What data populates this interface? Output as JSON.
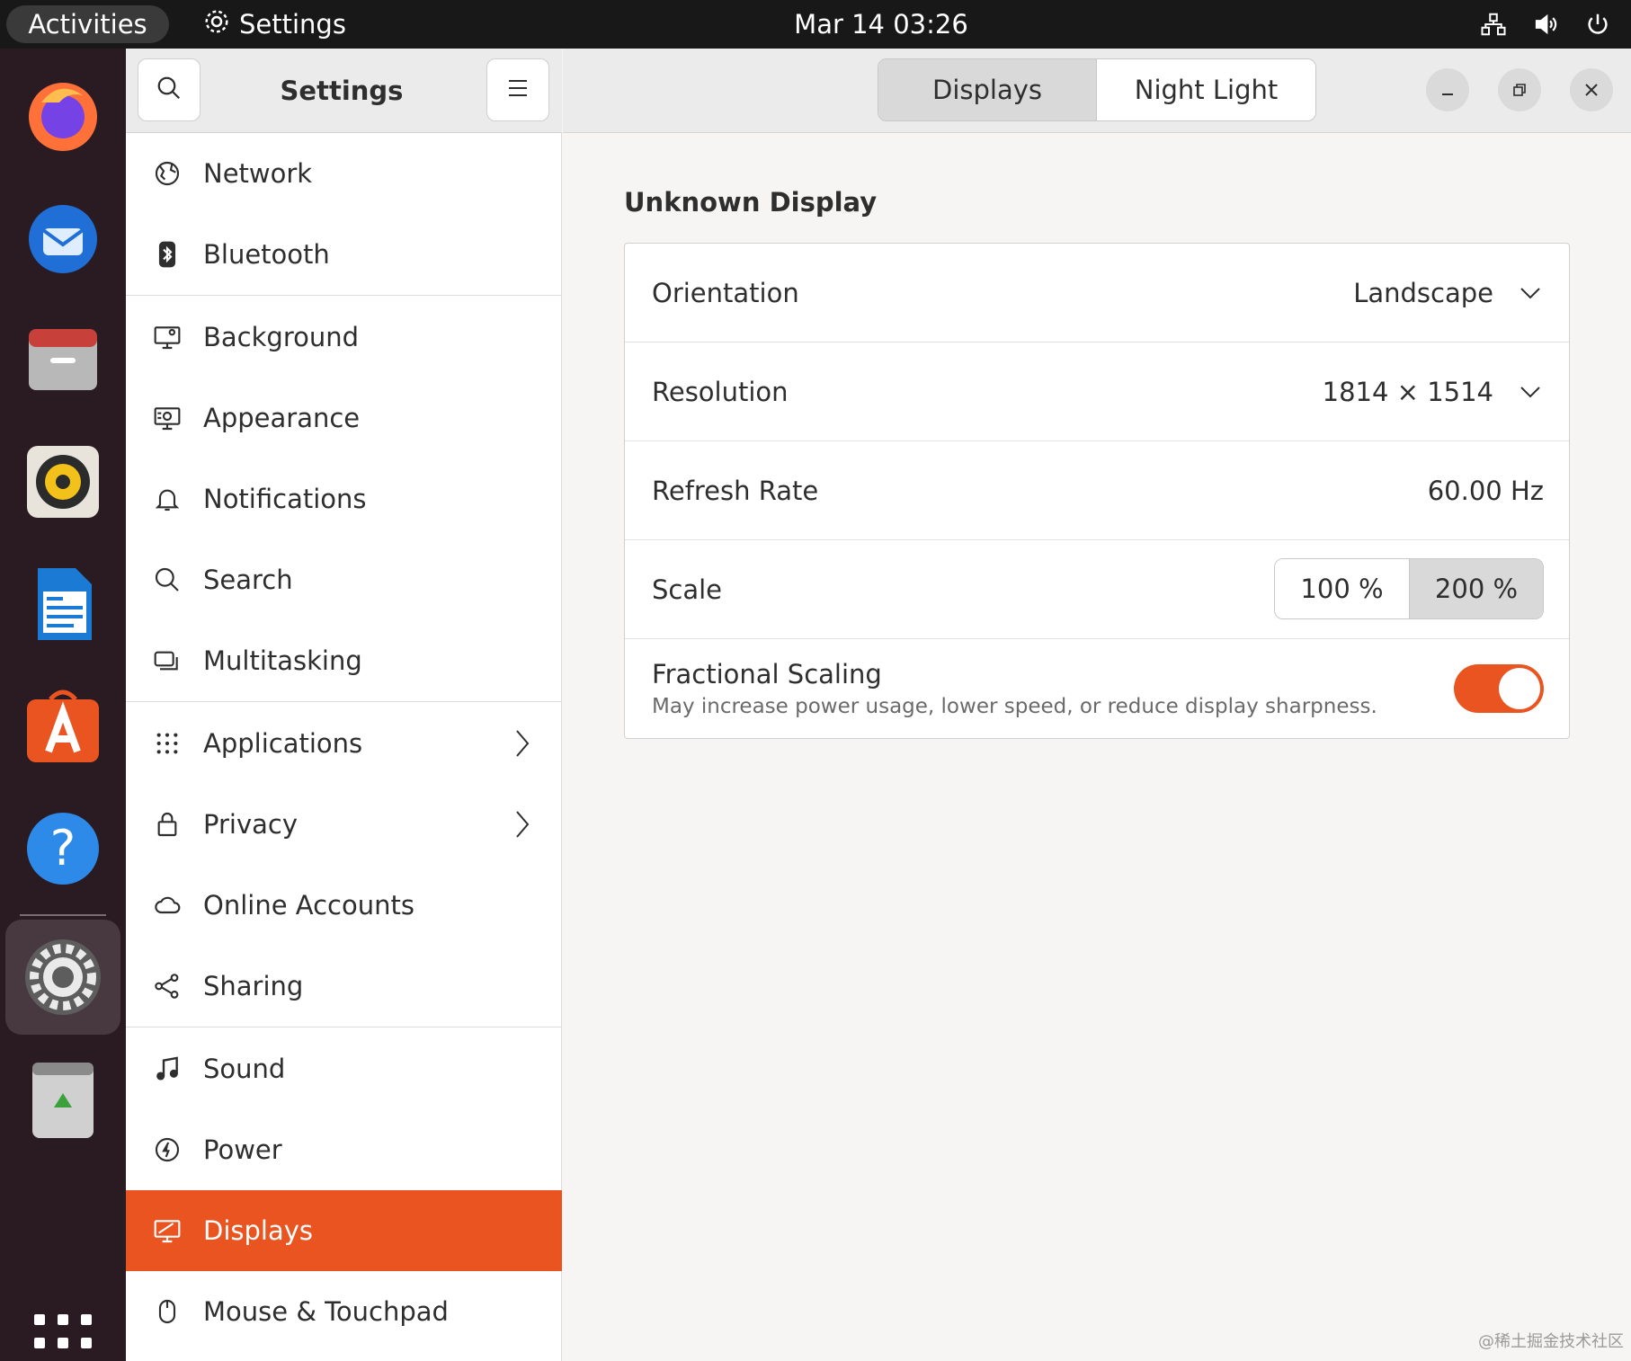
{
  "topbar": {
    "activities_label": "Activities",
    "app_name": "Settings",
    "clock": "Mar 14  03:26",
    "tray_icons": [
      "network-icon",
      "volume-icon",
      "power-icon"
    ]
  },
  "dock": {
    "items": [
      "firefox-icon",
      "thunderbird-icon",
      "files-icon",
      "rhythmbox-icon",
      "writer-icon",
      "app-center-icon",
      "help-icon",
      "settings-icon",
      "trash-icon"
    ],
    "active_item": "settings-icon"
  },
  "sidebar": {
    "title": "Settings",
    "items": [
      {
        "label": "Network",
        "icon": "network-icon"
      },
      {
        "label": "Bluetooth",
        "icon": "bluetooth-icon"
      },
      {
        "label": "Background",
        "icon": "background-icon"
      },
      {
        "label": "Appearance",
        "icon": "appearance-icon"
      },
      {
        "label": "Notifications",
        "icon": "bell-icon"
      },
      {
        "label": "Search",
        "icon": "search-icon"
      },
      {
        "label": "Multitasking",
        "icon": "multitasking-icon"
      },
      {
        "label": "Applications",
        "icon": "grid-icon"
      },
      {
        "label": "Privacy",
        "icon": "lock-icon"
      },
      {
        "label": "Online Accounts",
        "icon": "cloud-icon"
      },
      {
        "label": "Sharing",
        "icon": "share-icon"
      },
      {
        "label": "Sound",
        "icon": "music-note-icon"
      },
      {
        "label": "Power",
        "icon": "power-icon"
      },
      {
        "label": "Displays",
        "icon": "display-icon"
      },
      {
        "label": "Mouse & Touchpad",
        "icon": "mouse-icon"
      }
    ],
    "selected": "Displays"
  },
  "main": {
    "tabs": [
      {
        "label": "Displays"
      },
      {
        "label": "Night Light"
      }
    ],
    "active_tab": "Displays",
    "section_title": "Unknown Display",
    "orientation": {
      "label": "Orientation",
      "value": "Landscape"
    },
    "resolution": {
      "label": "Resolution",
      "value": "1814 × 1514"
    },
    "refresh_rate": {
      "label": "Refresh Rate",
      "value": "60.00 Hz"
    },
    "scale": {
      "label": "Scale",
      "options": [
        "100 %",
        "200 %"
      ],
      "selected": "200 %"
    },
    "fractional_scaling": {
      "label": "Fractional Scaling",
      "description": "May increase power usage, lower speed, or reduce display sharpness.",
      "enabled": true
    }
  },
  "watermark": "@稀土掘金技术社区",
  "colors": {
    "accent": "#e95420",
    "topbar": "#181818",
    "dock": "#2a1a22"
  }
}
